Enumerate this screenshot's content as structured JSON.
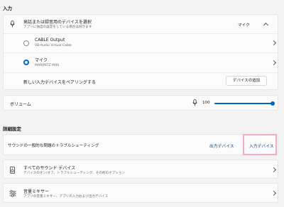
{
  "sections": {
    "input_title": "入力",
    "advanced_title": "詳細設定"
  },
  "device_select": {
    "title": "発話または録音用のデバイスを選択",
    "subtitle": "アプリに独自の設定をしている場合は除きます",
    "current": "マイク"
  },
  "devices": [
    {
      "name": "CABLE Output",
      "detail": "VB-Audio Virtual Cable",
      "selected": false
    },
    {
      "name": "マイク",
      "detail": "MARANTZ M4U",
      "selected": true
    }
  ],
  "pair": {
    "label": "新しい入力デバイスをペアリングする",
    "button": "デバイスの追加"
  },
  "volume": {
    "label": "ボリューム",
    "value": "100",
    "level": 1.0
  },
  "troubleshoot": {
    "label": "サウンドの一般的な問題のトラブルシューティング",
    "output_link": "出力デバイス",
    "input_link": "入力デバイス"
  },
  "advanced_items": [
    {
      "title": "すべてのサウンド デバイス",
      "subtitle": "デバイスのオン/オフ、トラブルシューティング、その他のオプション"
    },
    {
      "title": "音量ミキサー",
      "subtitle": "アプリの音量ミキサー、アプリの入力および出力デバイス"
    }
  ],
  "colors": {
    "accent": "#0067c0",
    "highlight": "#f5a9c8"
  }
}
